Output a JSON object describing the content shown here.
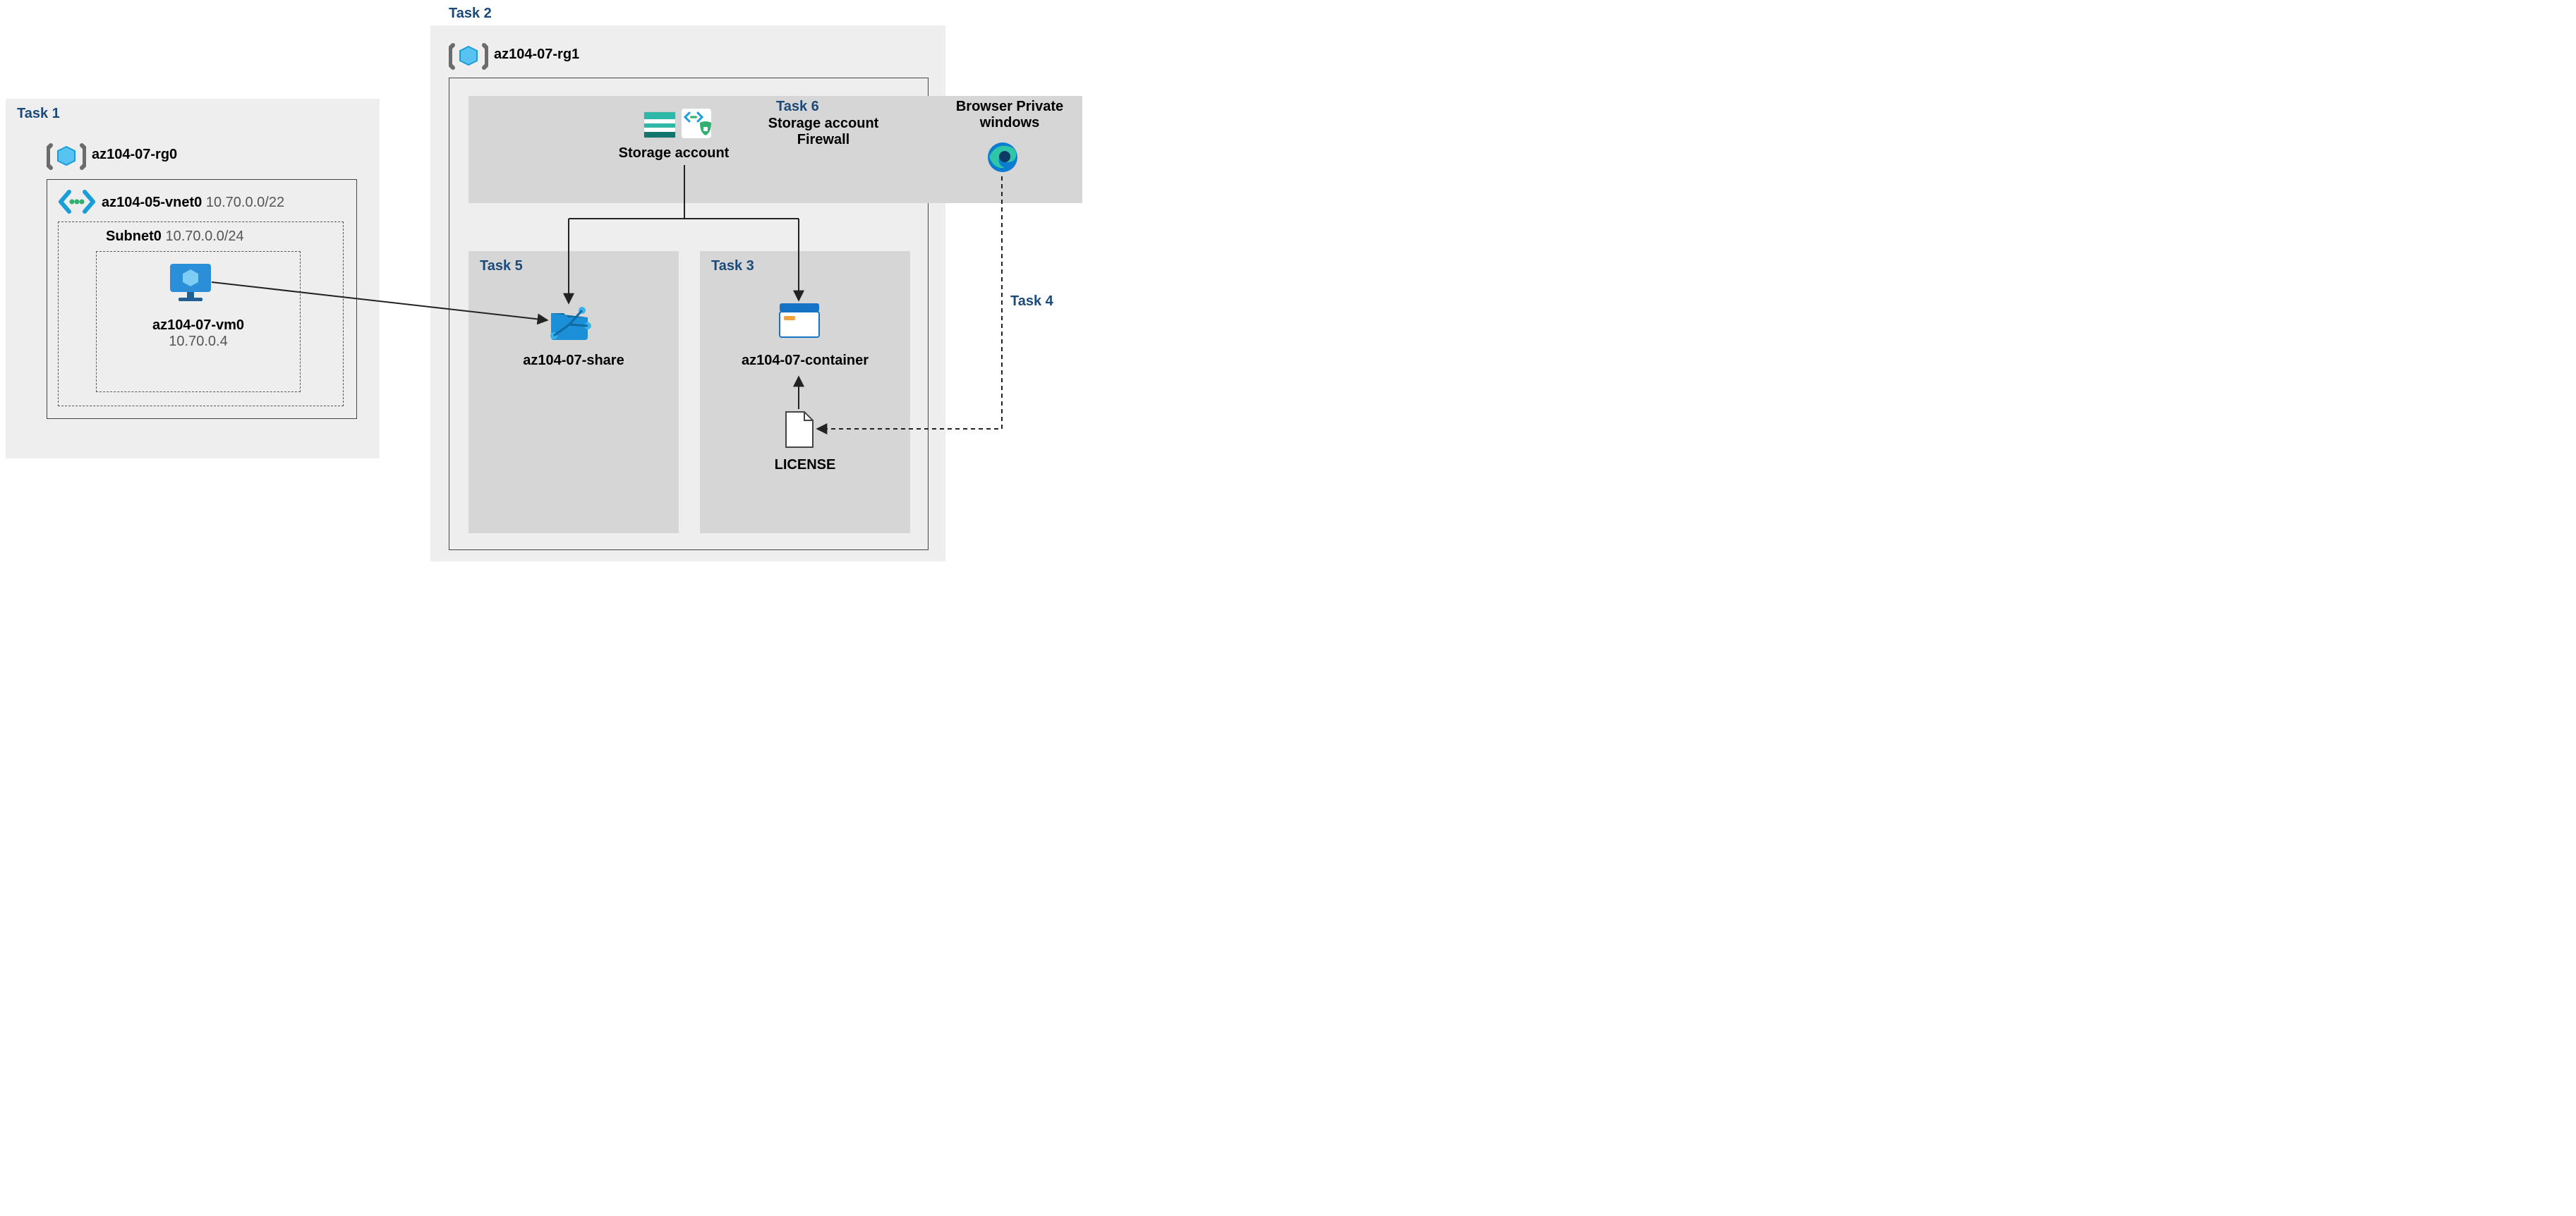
{
  "task1": {
    "label": "Task 1",
    "rg": "az104-07-rg0",
    "vnet_name": "az104-05-vnet0",
    "vnet_cidr": "10.70.0.0/22",
    "subnet_name": "Subnet0",
    "subnet_cidr": "10.70.0.0/24",
    "vm_name": "az104-07-vm0",
    "vm_ip": "10.70.0.4"
  },
  "task2": {
    "label": "Task 2",
    "rg": "az104-07-rg1",
    "storage_label": "Storage account"
  },
  "task3": {
    "label": "Task 3",
    "container_name": "az104-07-container",
    "file": "LICENSE"
  },
  "task4": {
    "label": "Task 4",
    "browser_label": "Browser Private\nwindows"
  },
  "task5": {
    "label": "Task 5",
    "share_name": "az104-07-share"
  },
  "task6": {
    "label": "Task 6",
    "title": "Storage account\nFirewall"
  }
}
